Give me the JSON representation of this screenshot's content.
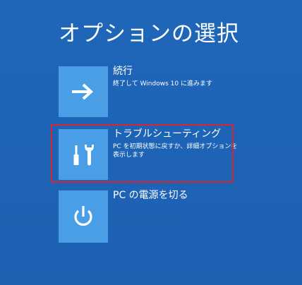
{
  "page": {
    "title": "オプションの選択"
  },
  "options": [
    {
      "id": "continue",
      "label": "続行",
      "description": "終了して Windows 10 に進みます",
      "icon": "arrow-right-icon"
    },
    {
      "id": "troubleshoot",
      "label": "トラブルシューティング",
      "description": "PC を初期状態に戻すか、詳細オプションを表示します",
      "icon": "screwdriver-wrench-icon"
    },
    {
      "id": "power",
      "label": "PC の電源を切る",
      "description": "",
      "icon": "power-icon"
    }
  ],
  "colors": {
    "background": "#1e63b6",
    "tile": "#4a9ee6",
    "highlight": "#d9262e",
    "text": "#ffffff"
  }
}
